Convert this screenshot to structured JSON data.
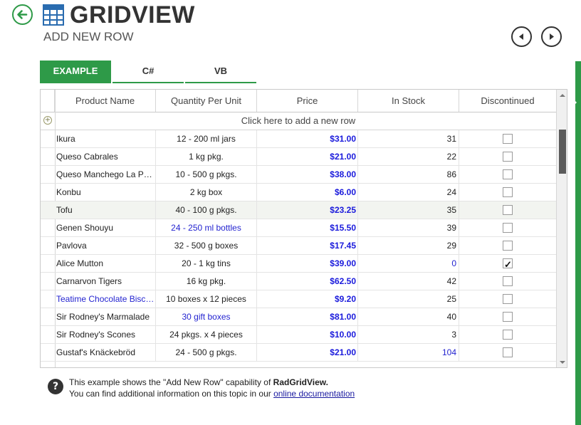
{
  "header": {
    "title": "GRIDVIEW",
    "subtitle": "ADD NEW ROW",
    "back_icon": "arrow-left-circle",
    "accent": "#2e9a48"
  },
  "tabs": [
    {
      "label": "EXAMPLE",
      "active": true
    },
    {
      "label": "C#",
      "active": false
    },
    {
      "label": "VB",
      "active": false
    }
  ],
  "grid": {
    "columns": [
      "Product Name",
      "Quantity Per Unit",
      "Price",
      "In Stock",
      "Discontinued"
    ],
    "add_row_text": "Click here to add a new row",
    "rows": [
      {
        "name": "Ikura",
        "qty": "12 - 200 ml jars",
        "price": "$31.00",
        "stock": "31",
        "discontinued": false
      },
      {
        "name": "Queso Cabrales",
        "qty": "1 kg pkg.",
        "price": "$21.00",
        "stock": "22",
        "discontinued": false
      },
      {
        "name": "Queso Manchego La Pastora",
        "qty": "10 - 500 g pkgs.",
        "price": "$38.00",
        "stock": "86",
        "discontinued": false
      },
      {
        "name": "Konbu",
        "qty": "2 kg box",
        "price": "$6.00",
        "stock": "24",
        "discontinued": false
      },
      {
        "name": "Tofu",
        "qty": "40 - 100 g pkgs.",
        "price": "$23.25",
        "stock": "35",
        "discontinued": false,
        "selected": true
      },
      {
        "name": "Genen Shouyu",
        "qty": "24 - 250 ml bottles",
        "price": "$15.50",
        "stock": "39",
        "discontinued": false,
        "qty_blue": true
      },
      {
        "name": "Pavlova",
        "qty": "32 - 500 g boxes",
        "price": "$17.45",
        "stock": "29",
        "discontinued": false
      },
      {
        "name": "Alice Mutton",
        "qty": "20 - 1 kg tins",
        "price": "$39.00",
        "stock": "0",
        "discontinued": true,
        "stock_blue": true
      },
      {
        "name": "Carnarvon Tigers",
        "qty": "16 kg pkg.",
        "price": "$62.50",
        "stock": "42",
        "discontinued": false
      },
      {
        "name": "Teatime Chocolate Biscuits",
        "qty": "10 boxes x 12 pieces",
        "price": "$9.20",
        "stock": "25",
        "discontinued": false,
        "name_blue": true
      },
      {
        "name": "Sir Rodney's Marmalade",
        "qty": "30 gift boxes",
        "price": "$81.00",
        "stock": "40",
        "discontinued": false,
        "qty_blue": true
      },
      {
        "name": "Sir Rodney's Scones",
        "qty": "24 pkgs. x 4 pieces",
        "price": "$10.00",
        "stock": "3",
        "discontinued": false
      },
      {
        "name": "Gustaf's Knäckebröd",
        "qty": "24 - 500 g pkgs.",
        "price": "$21.00",
        "stock": "104",
        "discontinued": false,
        "stock_blue": true
      }
    ]
  },
  "info": {
    "line1_prefix": "This example shows the \"Add New Row\" capability of ",
    "line1_bold": "RadGridView.",
    "line2_prefix": "You can find additional information on this topic in our ",
    "link_text": "online documentation"
  }
}
